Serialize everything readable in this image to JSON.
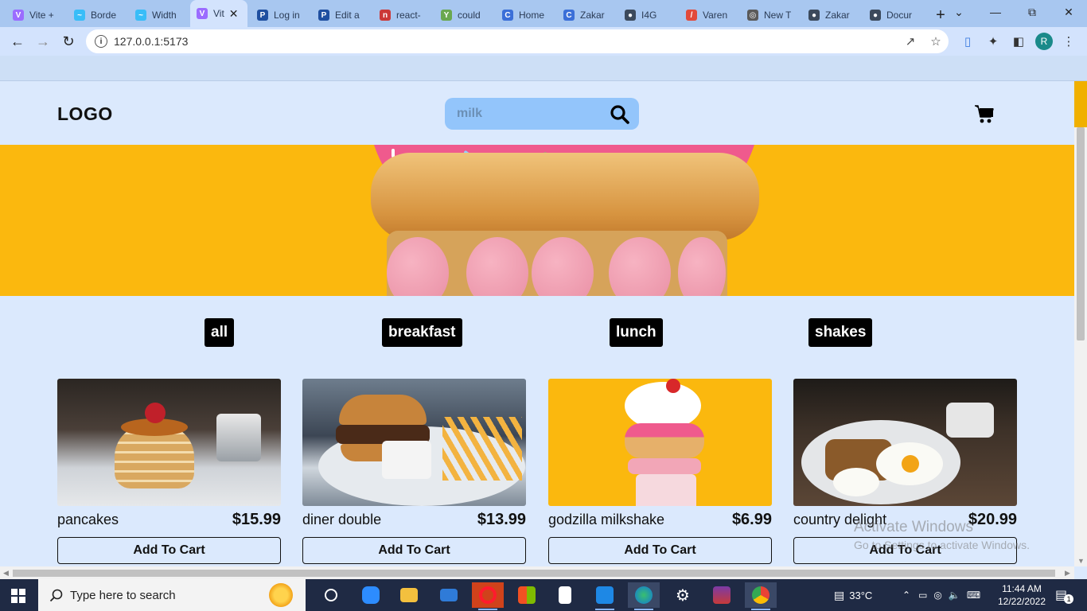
{
  "browser": {
    "tabs": [
      {
        "label": "Vite +",
        "icon": "vite-icon",
        "color": "#9b6cff",
        "glyph": "V"
      },
      {
        "label": "Borde",
        "icon": "tailwind-icon",
        "color": "#38bdf8",
        "glyph": "~"
      },
      {
        "label": "Width",
        "icon": "tailwind-icon",
        "color": "#38bdf8",
        "glyph": "~"
      },
      {
        "label": "Vit",
        "icon": "vite-icon",
        "color": "#9b6cff",
        "glyph": "V",
        "active": true
      },
      {
        "label": "Log in",
        "icon": "paypal-icon",
        "color": "#1f4fa0",
        "glyph": "P"
      },
      {
        "label": "Edit a",
        "icon": "paypal-icon",
        "color": "#1f4fa0",
        "glyph": "P"
      },
      {
        "label": "react-",
        "icon": "npm-icon",
        "color": "#cb3837",
        "glyph": "n"
      },
      {
        "label": "could",
        "icon": "ycombinator-icon",
        "color": "#6aa84f",
        "glyph": "Y"
      },
      {
        "label": "Home",
        "icon": "edge-c-icon",
        "color": "#3b6fd8",
        "glyph": "C"
      },
      {
        "label": "Zakar",
        "icon": "edge-c-icon",
        "color": "#3b6fd8",
        "glyph": "C"
      },
      {
        "label": "I4G",
        "icon": "globe-icon",
        "color": "#3c4a5c",
        "glyph": "●"
      },
      {
        "label": "Varen",
        "icon": "figma-icon",
        "color": "#e24a3b",
        "glyph": "/"
      },
      {
        "label": "New T",
        "icon": "chrome-icon",
        "color": "#5a5a5a",
        "glyph": "◎"
      },
      {
        "label": "Zakar",
        "icon": "globe-icon",
        "color": "#3c4a5c",
        "glyph": "●"
      },
      {
        "label": "Docur",
        "icon": "globe-icon",
        "color": "#3c4a5c",
        "glyph": "●"
      }
    ],
    "url": "127.0.0.1:5173",
    "profile_initial": "R"
  },
  "page": {
    "logo": "LOGO",
    "search": {
      "value": "milk",
      "placeholder": ""
    },
    "categories": [
      "all",
      "breakfast",
      "lunch",
      "shakes"
    ],
    "products": [
      {
        "name": "pancakes",
        "price": "$15.99",
        "button": "Add To Cart"
      },
      {
        "name": "diner double",
        "price": "$13.99",
        "button": "Add To Cart"
      },
      {
        "name": "godzilla milkshake",
        "price": "$6.99",
        "button": "Add To Cart"
      },
      {
        "name": "country delight",
        "price": "$20.99",
        "button": "Add To Cart"
      }
    ],
    "watermark": {
      "title": "Activate Windows",
      "subtitle": "Go to Settings to activate Windows."
    }
  },
  "taskbar": {
    "search_placeholder": "Type here to search",
    "temperature": "33°C",
    "time": "11:44 AM",
    "date": "12/22/2022",
    "notification_count": "1"
  },
  "colors": {
    "hero_background": "#fbb80e",
    "search_background": "#93c5fb",
    "page_background": "#dbe9fd",
    "button_black": "#000000"
  }
}
